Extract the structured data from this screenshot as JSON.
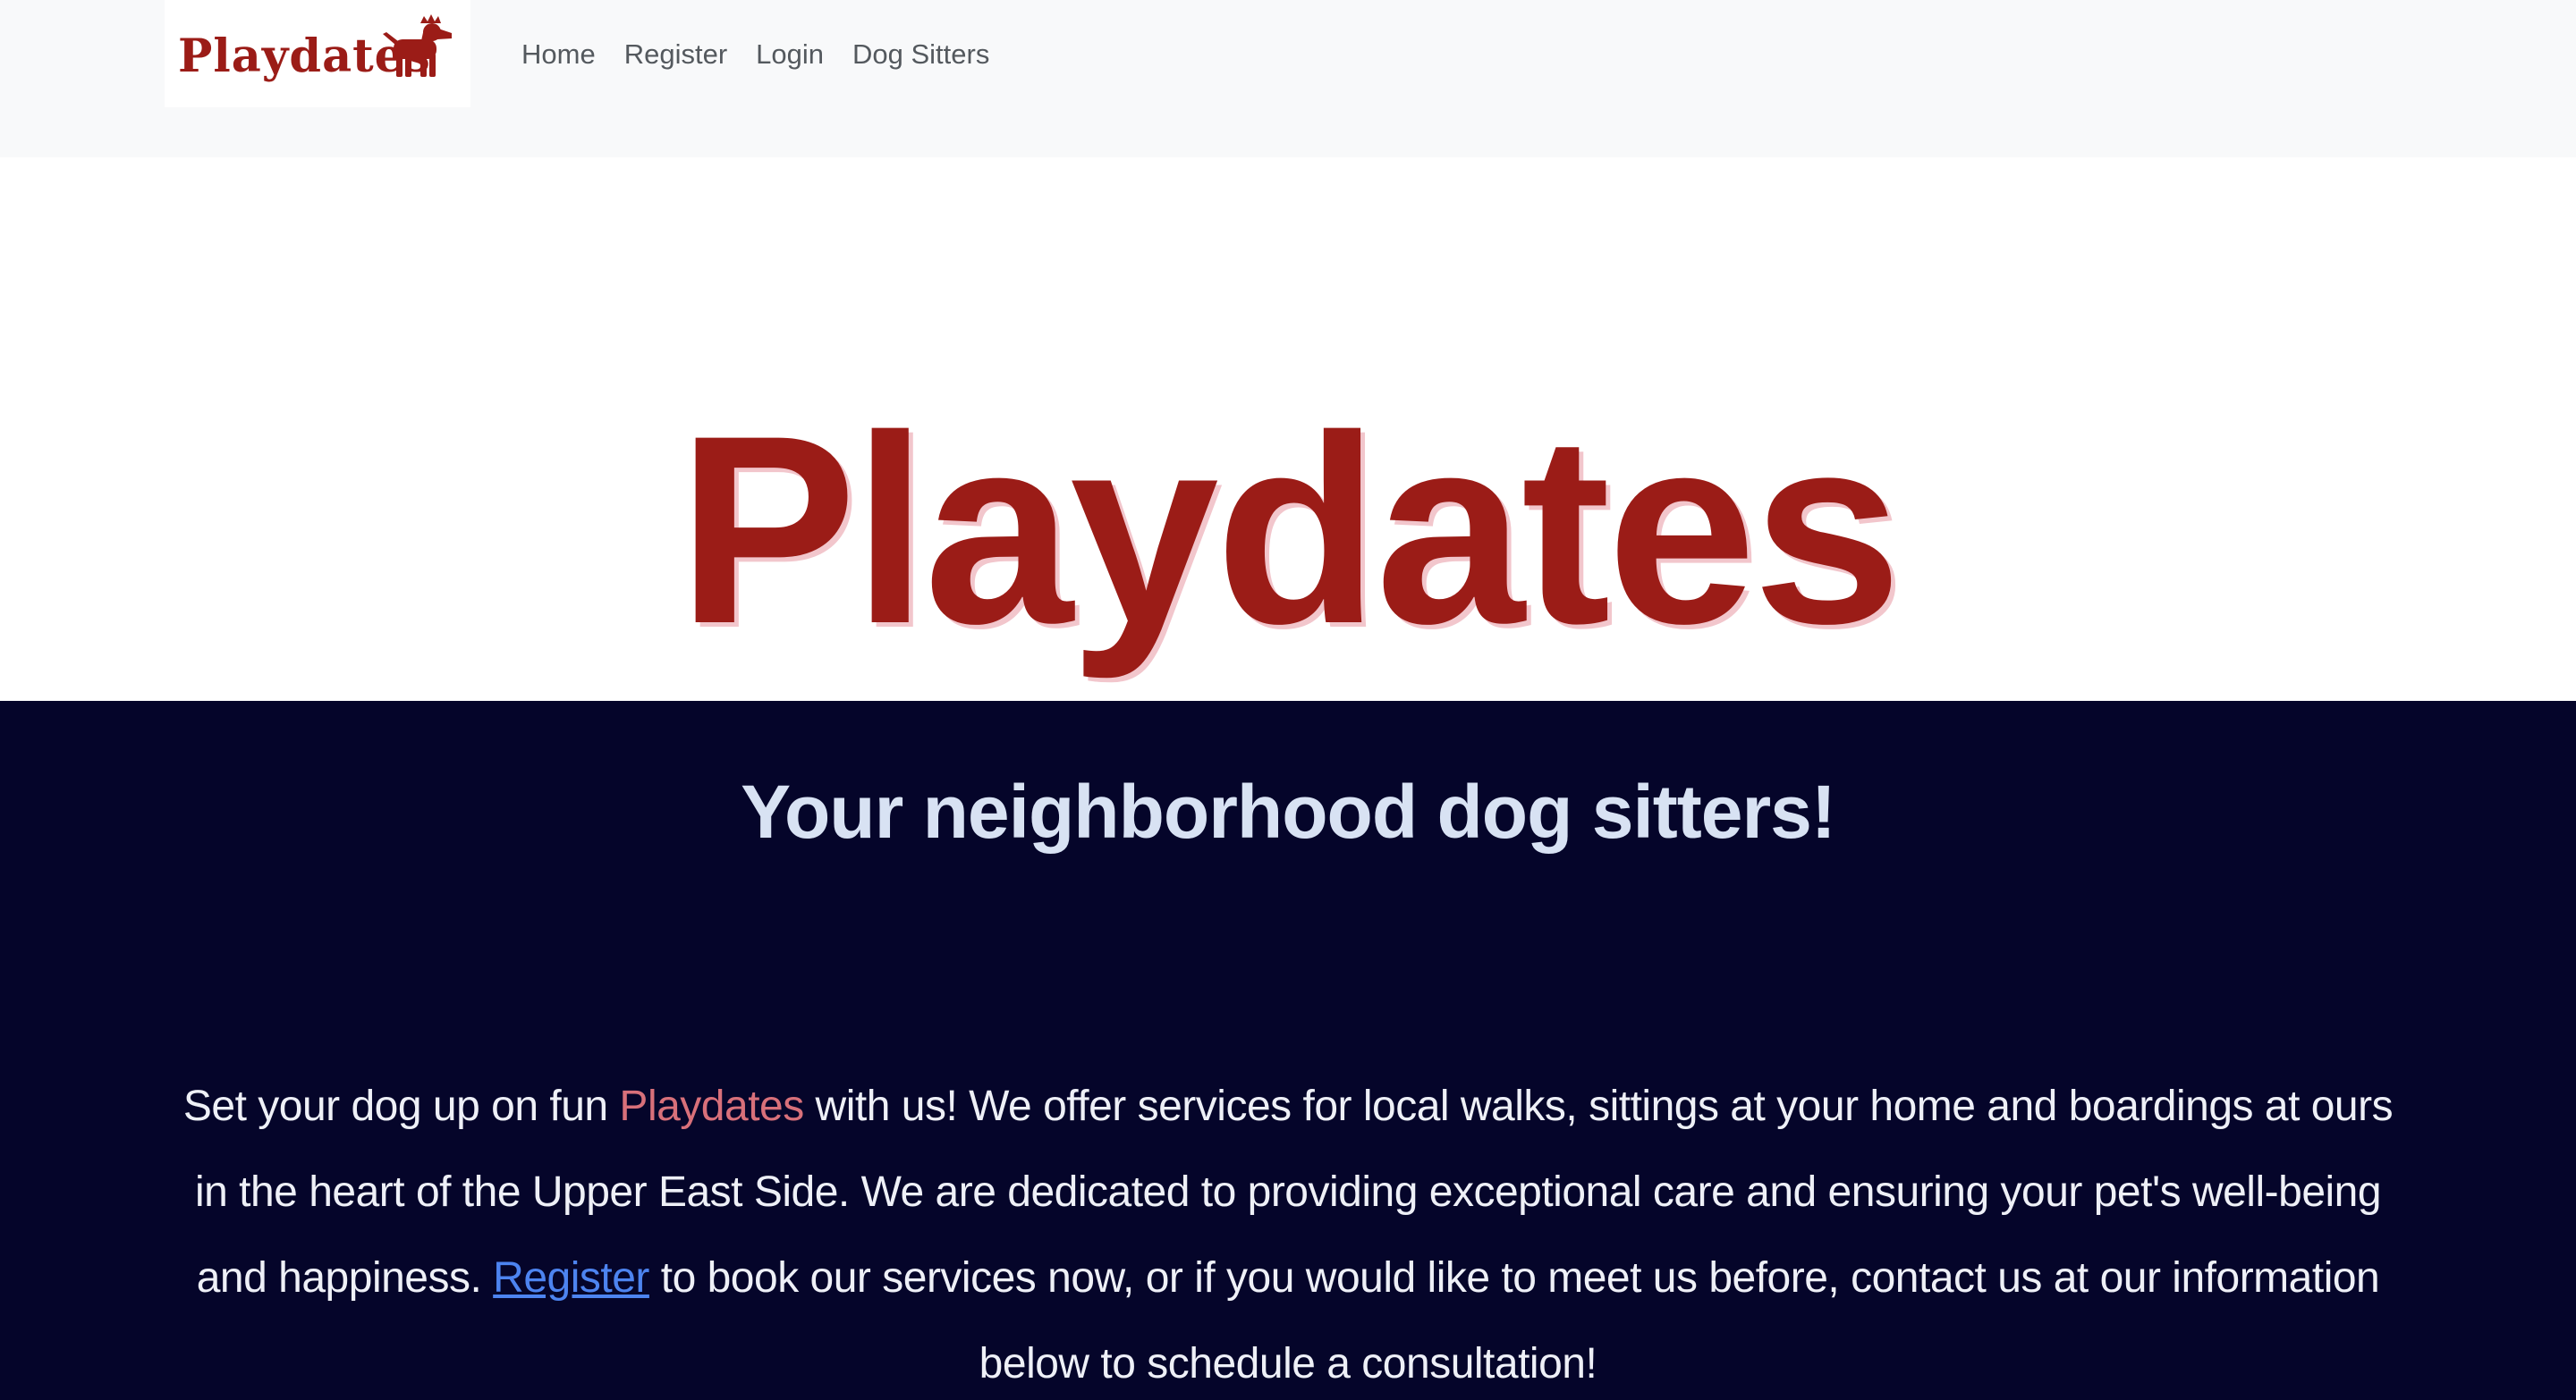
{
  "navbar": {
    "brand_text": "Playdates",
    "brand_color": "#9b1c17",
    "links": [
      {
        "label": "Home"
      },
      {
        "label": "Register"
      },
      {
        "label": "Login"
      },
      {
        "label": "Dog Sitters"
      }
    ]
  },
  "hero": {
    "title": "Playdates"
  },
  "section": {
    "background_color": "#05052a",
    "tagline": "Your neighborhood dog sitters!",
    "intro": {
      "part1": "Set your dog up on fun ",
      "brand_word": "Playdates",
      "part2": " with us! We offer services for local walks, sittings at your home and boardings at ours in the heart of the Upper East Side. We are dedicated to providing exceptional care and ensuring your pet's well-being and happiness. ",
      "register_link": "Register",
      "part3": " to book our services now, or if you would like to meet us before, contact us at our information below to schedule a consultation!"
    }
  },
  "icons": {
    "logo": "dog-with-crown-icon"
  }
}
